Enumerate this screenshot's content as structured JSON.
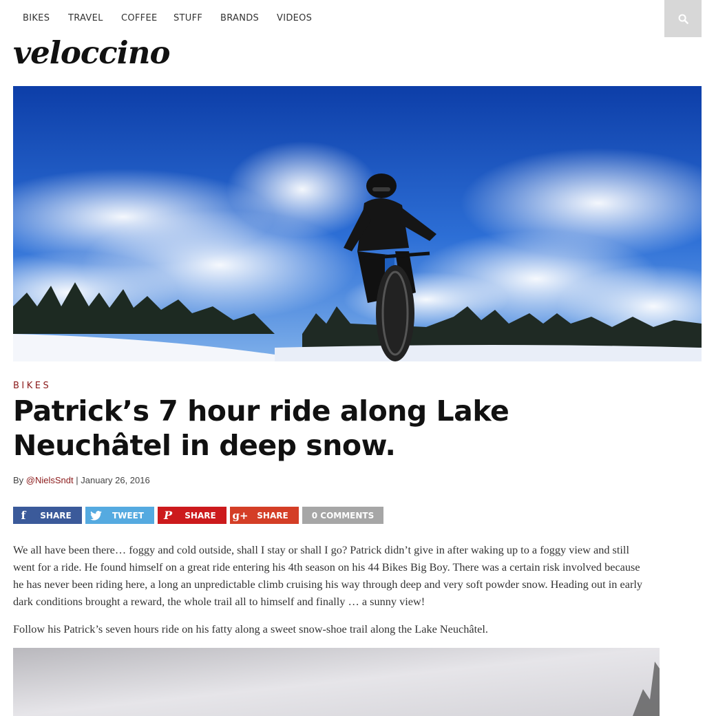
{
  "nav": {
    "items": [
      "BIKES",
      "TRAVEL",
      "COFFEE",
      "STUFF",
      "BRANDS",
      "VIDEOS"
    ],
    "search_icon": "search-icon"
  },
  "logo": {
    "text": "veloccino"
  },
  "article": {
    "category": "BIKES",
    "title": "Patrick’s 7 hour ride along Lake Neuchâtel in deep snow.",
    "byline_prefix": "By ",
    "author": "@NielsSndt",
    "date_sep": " | ",
    "date": "January 26, 2016",
    "paragraphs": [
      "We all have been there… foggy and cold outside, shall I stay or shall I go? Patrick didn’t give in after waking up to a foggy view and still went for a ride. He found himself on a great ride entering his 4th season on his 44 Bikes Big Boy. There was a certain risk involved because he has never been riding here,  a long an unpredictable climb cruising his way through deep and very soft powder snow. Heading out in early dark conditions brought a reward, the whole trail all to himself and finally … a sunny view!",
      "Follow his Patrick’s seven hours ride on his fatty along a sweet snow-shoe trail along the Lake Neuchâtel."
    ]
  },
  "share": {
    "facebook": {
      "label": "SHARE",
      "color": "#3b5a9a",
      "icon": "facebook-icon"
    },
    "twitter": {
      "label": "TWEET",
      "color": "#55aae0",
      "icon": "twitter-icon"
    },
    "pinterest": {
      "label": "SHARE",
      "color": "#cc1a1c",
      "icon": "pinterest-icon"
    },
    "google": {
      "label": "SHARE",
      "color": "#d43e26",
      "icon": "google-plus-icon",
      "glyph": "g+"
    },
    "comments": {
      "label": "0 COMMENTS",
      "color": "#a6a6a6"
    }
  },
  "colors": {
    "accent": "#8b1a1a",
    "sky": "#1f5fc6"
  }
}
